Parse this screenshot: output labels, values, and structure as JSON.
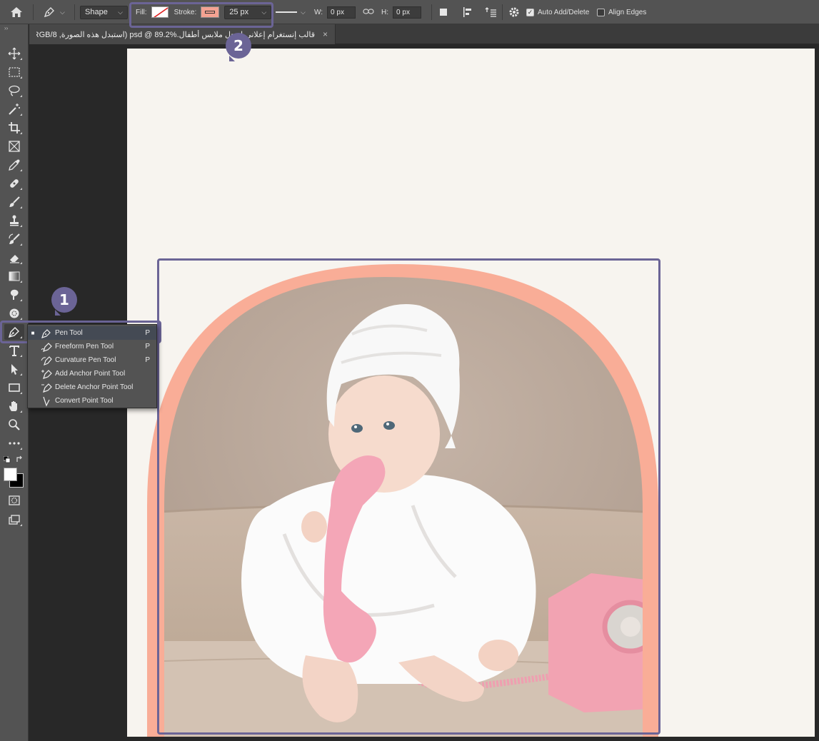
{
  "options_bar": {
    "mode": "Shape",
    "fill_label": "Fill:",
    "stroke_label": "Stroke:",
    "stroke_width": "25 px",
    "w_label": "W:",
    "w_value": "0 px",
    "h_label": "H:",
    "h_value": "0 px",
    "auto_add_delete": "Auto Add/Delete",
    "align_edges": "Align Edges",
    "stroke_color": "#f4a292"
  },
  "document": {
    "tab_title": "قالب إنستغرام إعلاني لمحل ملابس أطفال.psd @ 89.2% (استبدل هذه الصورة, RGB/8)"
  },
  "flyout": {
    "items": [
      {
        "label": "Pen Tool",
        "shortcut": "P",
        "active": true
      },
      {
        "label": "Freeform Pen Tool",
        "shortcut": "P"
      },
      {
        "label": "Curvature Pen Tool",
        "shortcut": "P"
      },
      {
        "label": "Add Anchor Point Tool",
        "shortcut": ""
      },
      {
        "label": "Delete Anchor Point Tool",
        "shortcut": ""
      },
      {
        "label": "Convert Point Tool",
        "shortcut": ""
      }
    ]
  },
  "annotations": {
    "badge_1": "1",
    "badge_2": "2",
    "color": "#6b6496"
  },
  "colors": {
    "arch": "#f9ad97",
    "canvas_bg": "#f7f4ef"
  }
}
